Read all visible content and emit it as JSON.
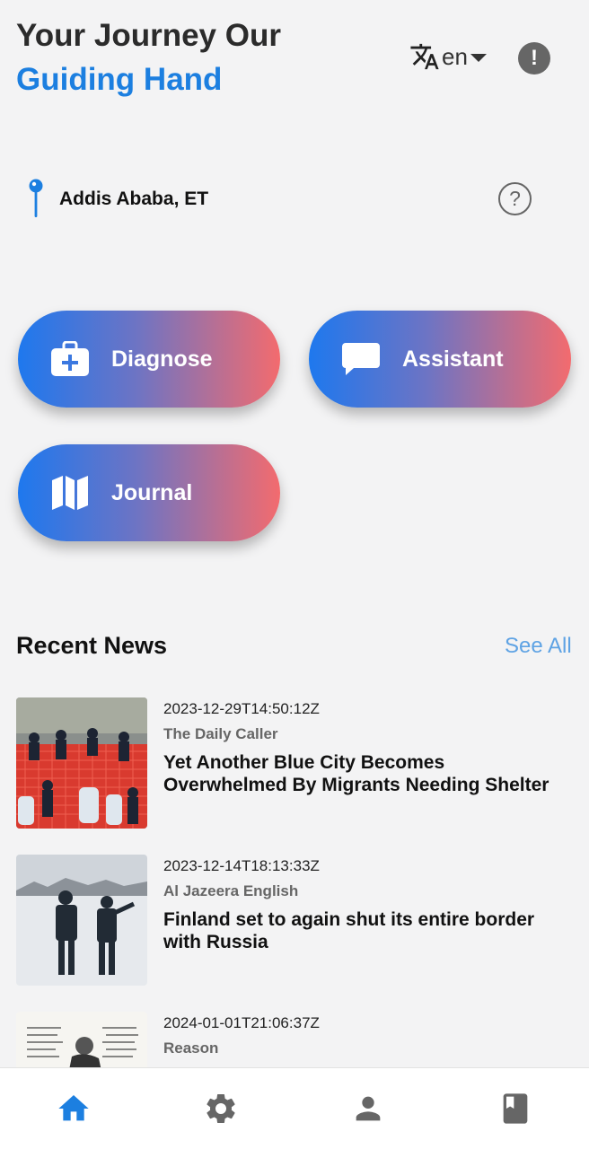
{
  "header": {
    "title_line1": "Your Journey Our",
    "title_line2": "Guiding Hand",
    "language_code": "en",
    "accent_color": "#1c7fe0"
  },
  "location": {
    "label": "Addis Ababa, ET"
  },
  "actions": [
    {
      "label": "Diagnose",
      "icon": "medical-kit-icon"
    },
    {
      "label": "Assistant",
      "icon": "chat-bubble-icon"
    },
    {
      "label": "Journal",
      "icon": "map-icon"
    }
  ],
  "news": {
    "heading": "Recent News",
    "see_all_label": "See All",
    "items": [
      {
        "date": "2023-12-29T14:50:12Z",
        "source": "The Daily Caller",
        "title": "Yet Another Blue City Becomes Overwhelmed By Migrants Needing Shelter"
      },
      {
        "date": "2023-12-14T18:13:33Z",
        "source": "Al Jazeera English",
        "title": "Finland set to again shut its entire border with Russia"
      },
      {
        "date": "2024-01-01T21:06:37Z",
        "source": "Reason",
        "title": ""
      }
    ]
  },
  "bottom_nav": {
    "items": [
      "home-icon",
      "gear-icon",
      "person-icon",
      "book-icon"
    ],
    "active": "home-icon",
    "active_color": "#1c7fe0",
    "inactive_color": "#666666"
  }
}
